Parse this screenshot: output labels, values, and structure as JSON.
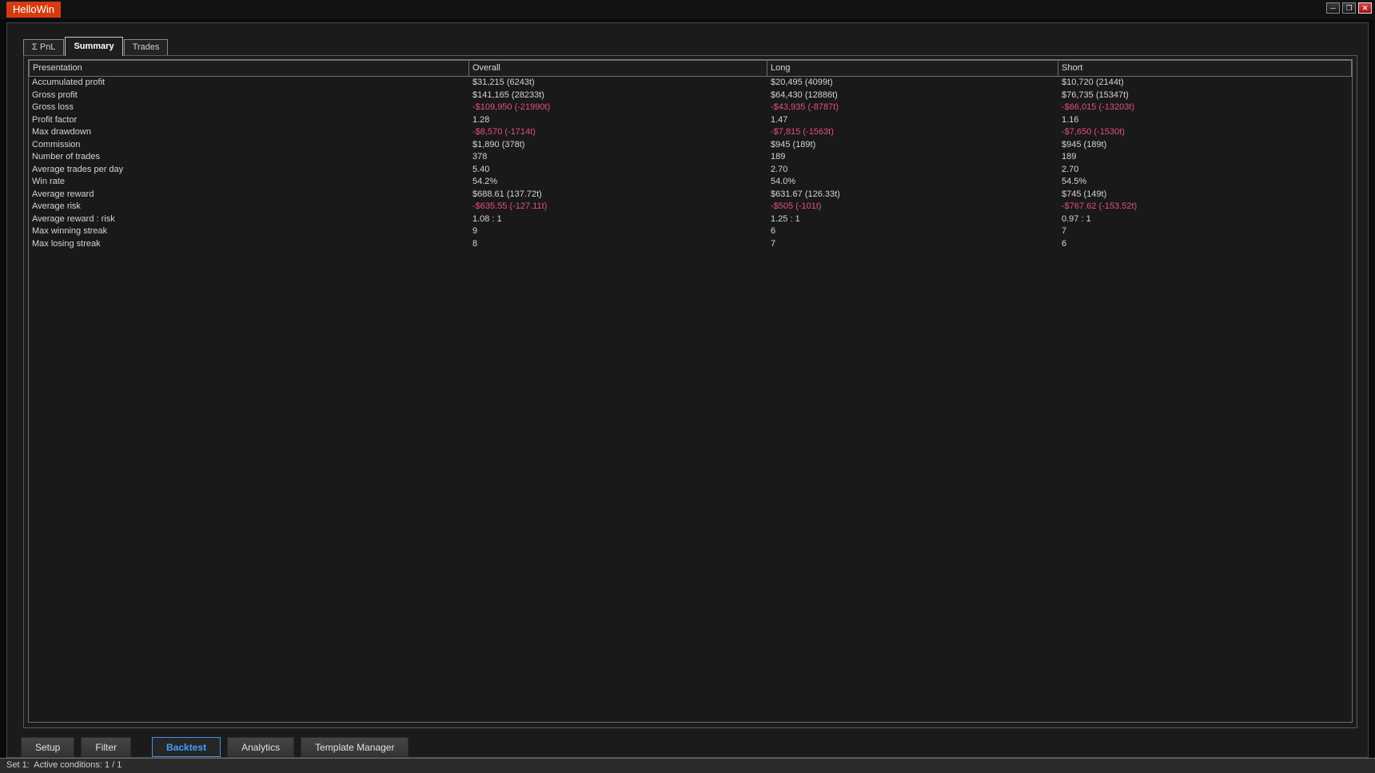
{
  "window": {
    "title": "HelloWin",
    "controls": {
      "minimize_icon": "minimize-icon",
      "restore_icon": "restore-icon",
      "close_icon": "close-icon",
      "minimize_glyph": "─",
      "restore_glyph": "❐",
      "close_glyph": "✕"
    }
  },
  "top_tabs": [
    {
      "label": "Σ PnL",
      "active": false
    },
    {
      "label": "Summary",
      "active": true
    },
    {
      "label": "Trades",
      "active": false
    }
  ],
  "table": {
    "columns": [
      "Presentation",
      "Overall",
      "Long",
      "Short"
    ],
    "rows": [
      {
        "label": "Accumulated profit",
        "overall": "$31,215 (6243t)",
        "long": "$20,495 (4099t)",
        "short": "$10,720 (2144t)",
        "negative": false
      },
      {
        "label": "Gross profit",
        "overall": "$141,165 (28233t)",
        "long": "$64,430 (12886t)",
        "short": "$76,735 (15347t)",
        "negative": false
      },
      {
        "label": "Gross loss",
        "overall": "-$109,950 (-21990t)",
        "long": "-$43,935 (-8787t)",
        "short": "-$66,015 (-13203t)",
        "negative": true
      },
      {
        "label": "Profit factor",
        "overall": "1.28",
        "long": "1.47",
        "short": "1.16",
        "negative": false
      },
      {
        "label": "Max drawdown",
        "overall": "-$8,570 (-1714t)",
        "long": "-$7,815 (-1563t)",
        "short": "-$7,650 (-1530t)",
        "negative": true
      },
      {
        "label": "Commission",
        "overall": "$1,890 (378t)",
        "long": "$945 (189t)",
        "short": "$945 (189t)",
        "negative": false
      },
      {
        "label": "Number of trades",
        "overall": "378",
        "long": "189",
        "short": "189",
        "negative": false
      },
      {
        "label": "Average trades per day",
        "overall": "5.40",
        "long": "2.70",
        "short": "2.70",
        "negative": false
      },
      {
        "label": "Win rate",
        "overall": "54.2%",
        "long": "54.0%",
        "short": "54.5%",
        "negative": false
      },
      {
        "label": "Average reward",
        "overall": "$688.61 (137.72t)",
        "long": "$631.67 (126.33t)",
        "short": "$745 (149t)",
        "negative": false
      },
      {
        "label": "Average risk",
        "overall": "-$635.55 (-127.11t)",
        "long": "-$505 (-101t)",
        "short": "-$767.62 (-153.52t)",
        "negative": true
      },
      {
        "label": "Average reward : risk",
        "overall": "1.08 : 1",
        "long": "1.25 : 1",
        "short": "0.97 : 1",
        "negative": false
      },
      {
        "label": "Max winning streak",
        "overall": "9",
        "long": "6",
        "short": "7",
        "negative": false
      },
      {
        "label": "Max losing streak",
        "overall": "8",
        "long": "7",
        "short": "6",
        "negative": false
      }
    ]
  },
  "bottom_tabs": [
    {
      "label": "Setup",
      "active": false
    },
    {
      "label": "Filter",
      "active": false
    },
    {
      "label": "Backtest",
      "active": true
    },
    {
      "label": "Analytics",
      "active": false
    },
    {
      "label": "Template Manager",
      "active": false
    }
  ],
  "status_bar": {
    "text": "Set 1:  Active conditions: 1 / 1"
  },
  "colors": {
    "title_accent": "#d63b10",
    "negative_value": "#e24f87",
    "active_bottom_tab": "#42a0ff",
    "close_button": "#b01818"
  }
}
